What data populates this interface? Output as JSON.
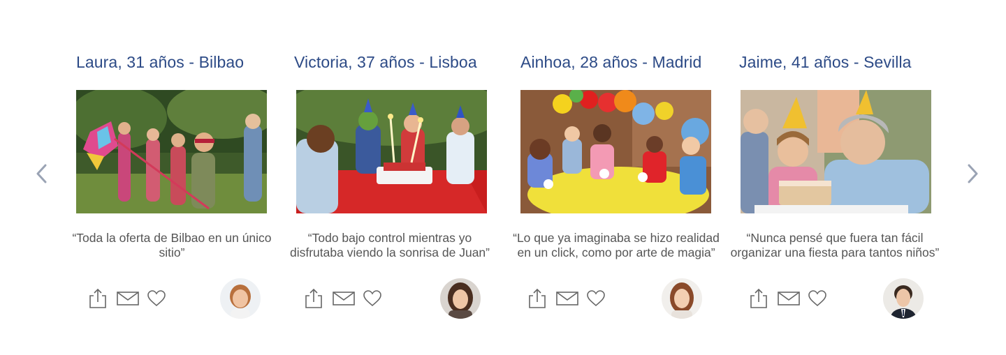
{
  "carousel": {
    "prev_icon": "chevron-left-icon",
    "next_icon": "chevron-right-icon",
    "title_color": "#2c4a86",
    "cards": [
      {
        "title": "Laura, 31 años - Bilbao",
        "quote": "“Toda la oferta de Bilbao en un único sitio”",
        "photo": "children-with-pinata-photo",
        "avatar": "woman-avatar",
        "actions": [
          "share-icon",
          "mail-icon",
          "heart-icon"
        ]
      },
      {
        "title": "Victoria, 37 años - Lisboa",
        "quote": "“Todo bajo control mientras yo disfrutaba viendo la sonrisa de Juan”",
        "photo": "kids-with-birthday-cake-photo",
        "avatar": "woman-avatar",
        "actions": [
          "share-icon",
          "mail-icon",
          "heart-icon"
        ]
      },
      {
        "title": "Ainhoa, 28 años - Madrid",
        "quote": "“Lo que ya imaginaba se hizo realidad en un click, como por arte de magia”",
        "photo": "party-table-with-balloons-photo",
        "avatar": "woman-avatar",
        "actions": [
          "share-icon",
          "mail-icon",
          "heart-icon"
        ]
      },
      {
        "title": "Jaime, 41 años - Sevilla",
        "quote": "“Nunca pensé que fuera tan fácil organizar una fiesta para tantos niños”",
        "photo": "grandmother-blowing-candles-photo",
        "avatar": "man-avatar",
        "actions": [
          "share-icon",
          "mail-icon",
          "heart-icon"
        ]
      }
    ]
  }
}
